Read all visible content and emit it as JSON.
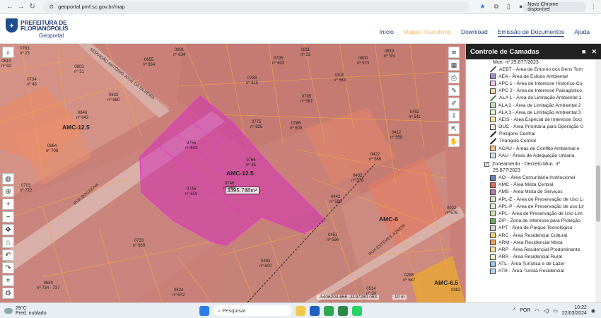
{
  "browser": {
    "url": "geoportal.pmf.sc.gov.br/map",
    "update_button": "Novo Chrome disponível"
  },
  "site": {
    "logo_line1": "PREFEITURA DE",
    "logo_line2": "FLORIANÓPOLIS",
    "logo_sub": "Geoportal",
    "nav": [
      "Início",
      "Mapas Interativos",
      "Download",
      "Emissão de Documentos",
      "Ajuda"
    ]
  },
  "map": {
    "zones": [
      "AMC-12.5",
      "AMC-12.5",
      "AMC-6",
      "AMC-6.5"
    ],
    "area_measure": "3395.788m²",
    "streets": [
      "RUA BOCAIÚVA",
      "SERVIDÃO ANTÔNIO JOSÉ DA SILVEIRA",
      "RUA ESTEVES JÚNIOR"
    ],
    "parcels": [
      {
        "code": "0619",
        "num": "nº 92"
      },
      {
        "code": "0763",
        "num": "nº 23"
      },
      {
        "code": "0734",
        "num": "nº 43"
      },
      {
        "code": "0803",
        "num": "nº 31"
      },
      {
        "code": "0833",
        "num": "nº 680"
      },
      {
        "code": "0846",
        "num": "nº 642"
      },
      {
        "code": "0864",
        "num": "nº 708"
      },
      {
        "code": "0855",
        "num": "nº 664"
      },
      {
        "code": "0891",
        "num": "nº 634"
      },
      {
        "code": "0795",
        "num": "nº 603"
      },
      {
        "code": "0811",
        "num": "nº 21"
      },
      {
        "code": "0783",
        "num": "nº 615"
      },
      {
        "code": "0810",
        "num": "nº 583"
      },
      {
        "code": "0819",
        "num": "nº SN"
      },
      {
        "code": "0785",
        "num": "nº 587"
      },
      {
        "code": "0800",
        "num": "nº 573"
      },
      {
        "code": "0775",
        "num": "nº 625"
      },
      {
        "code": "0786",
        "num": "nº 609"
      },
      {
        "code": "0402",
        "num": "nº 541"
      },
      {
        "code": "0412",
        "num": "nº 558"
      },
      {
        "code": "0422",
        "num": "nº 568"
      },
      {
        "code": "0432",
        "num": "nº 578"
      },
      {
        "code": "0442",
        "num": "nº 588"
      },
      {
        "code": "0451",
        "num": "nº 596"
      },
      {
        "code": "0755",
        "num": "nº 643"
      },
      {
        "code": "0765",
        "num": "nº 35"
      },
      {
        "code": "0746",
        "num": "nº 655"
      },
      {
        "code": "0745",
        "num": "nº 659"
      },
      {
        "code": "0733",
        "num": "nº 669"
      },
      {
        "code": "0493",
        "num": "nº 600"
      },
      {
        "code": "0680",
        "num": "nº 734 - 737"
      },
      {
        "code": "0524",
        "num": "nº 672"
      },
      {
        "code": "0514",
        "num": "nº 30"
      },
      {
        "code": "0288",
        "num": "nº 587"
      },
      {
        "code": "0022",
        "num": "nº 575"
      },
      {
        "code": "0082",
        "num": ""
      },
      {
        "code": "0703",
        "num": "nº 722"
      }
    ],
    "coordinates": "-5406204.866 -3197280.063",
    "scale": "10 m"
  },
  "layers": {
    "title": "Controle de Camadas",
    "group1_tail": "Mun. nº 25.877/2023",
    "group1": [
      {
        "label": "AEBT - Área de Entorno dos Bens Tom",
        "kind": "line",
        "color": "#555"
      },
      {
        "label": "AEA - Área de Estudo Ambiental",
        "kind": "box",
        "color": "#a58bd0"
      },
      {
        "label": "APC 1 - Área de Interesse Histórico-Cu",
        "kind": "box",
        "color": "#f4c6f0"
      },
      {
        "label": "APC 2 - Área de Interesse Paisagístico",
        "kind": "box",
        "color": "#f7d7a8"
      },
      {
        "label": "ALA 1 - Área de Limitação Ambiental 1",
        "kind": "line",
        "color": "#3b8a3b"
      },
      {
        "label": "ALA 2 - Área de Limitação Ambiental 2",
        "kind": "box",
        "color": "#c5e3c0"
      },
      {
        "label": "ALA 3 - Área de Limitação Ambiental 3",
        "kind": "box",
        "color": "#e6f2c7"
      },
      {
        "label": "AEIS - Área Especial de Interesse Soci",
        "kind": "box",
        "color": "#fbe3a6"
      },
      {
        "label": "OUC - Área Prioritária para Operação U",
        "kind": "box",
        "color": "#f2e3d8"
      },
      {
        "label": "Polígono Central",
        "kind": "line",
        "color": "#222"
      },
      {
        "label": "Triângulo Central",
        "kind": "line",
        "color": "#222"
      },
      {
        "label": "ACAU - Áreas de Conflito Ambiental e",
        "kind": "box",
        "color": "#f7c28a"
      },
      {
        "label": "AAU - Áreas de Adequação Urbana",
        "kind": "box",
        "color": "#cde2f3"
      }
    ],
    "group2_title": "Zoneamento - Decreto Mun. nº",
    "group2_sub": "25.877/2023",
    "group2": [
      {
        "label": "ACI - Área Comunitária Institucional",
        "kind": "box",
        "color": "#6e7fb3"
      },
      {
        "label": "AMC - Área Mista Central",
        "kind": "box",
        "color": "#e26a5b"
      },
      {
        "label": "AMS - Área Mista de Serviços",
        "kind": "box",
        "color": "#b77aa8"
      },
      {
        "label": "APL-E - Área de Preservação de Uso Li",
        "kind": "box",
        "color": "#d8e8c5"
      },
      {
        "label": "APL-P - Área de Preservação de uso Lir",
        "kind": "box",
        "color": "#e8f0d8"
      },
      {
        "label": "APL - Área de Preservação de Uso Lim",
        "kind": "box",
        "color": "#cfe3b6"
      },
      {
        "label": "ZIP - Zona de Interesse para Proteção",
        "kind": "box",
        "color": "#6faa5b"
      },
      {
        "label": "APT - Área de Parque Tecnológico",
        "kind": "box",
        "color": "#d3d3d3"
      },
      {
        "label": "ARC - Área Residencial Cultural",
        "kind": "box",
        "color": "#f5d070"
      },
      {
        "label": "ARM - Área Residencial Mista",
        "kind": "box",
        "color": "#f0a060"
      },
      {
        "label": "ARP - Área Residencial Predominante",
        "kind": "box",
        "color": "#fae29a"
      },
      {
        "label": "ARR - Área Residencial Rural",
        "kind": "box",
        "color": "#e9f2c0"
      },
      {
        "label": "ATL - Área Turística e de Lazer",
        "kind": "box",
        "color": "#9cc7e8"
      },
      {
        "label": "ATR - Área Turista Residencial",
        "kind": "box",
        "color": "#b8d6ee"
      }
    ]
  },
  "taskbar": {
    "temperature": "29°C",
    "weather": "Pred. nublado",
    "search": "Pesquisar",
    "lang": "POR",
    "time": "10:22",
    "date": "22/03/2024"
  }
}
